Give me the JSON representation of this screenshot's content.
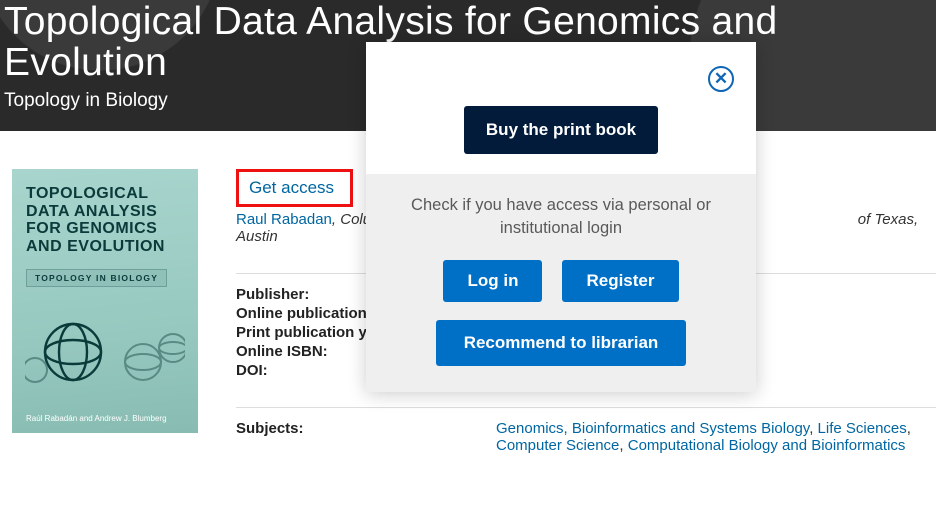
{
  "hero": {
    "title": "Topological Data Analysis for Genomics and Evolution",
    "subtitle": "Topology in Biology"
  },
  "cover": {
    "line1": "TOPOLOGICAL DATA ANALYSIS FOR GENOMICS AND EVOLUTION",
    "tag": "TOPOLOGY IN BIOLOGY",
    "authors": "Raúl Rabadán and Andrew J. Blumberg"
  },
  "access": {
    "get_access": "Get access"
  },
  "authors": {
    "a1_name": "Raul Rabadan",
    "a1_affil": ", Columbia University",
    "a2_tail": "of Texas, Austin"
  },
  "pub": {
    "publisher_lbl": "Publisher:",
    "online_date_lbl": "Online publication date:",
    "print_year_lbl": "Print publication year:",
    "online_isbn_lbl": "Online ISBN:",
    "doi_lbl": "DOI:"
  },
  "subjects": {
    "label": "Subjects:",
    "s1": "Genomics, Bioinformatics and Systems Biology",
    "s2": "Life Sciences",
    "s3": "Computer Science",
    "s4": "Computational Biology and Bioinformatics"
  },
  "modal": {
    "buy": "Buy the print book",
    "check": "Check if you have access via personal or institutional login",
    "login": "Log in",
    "register": "Register",
    "recommend": "Recommend to librarian"
  }
}
